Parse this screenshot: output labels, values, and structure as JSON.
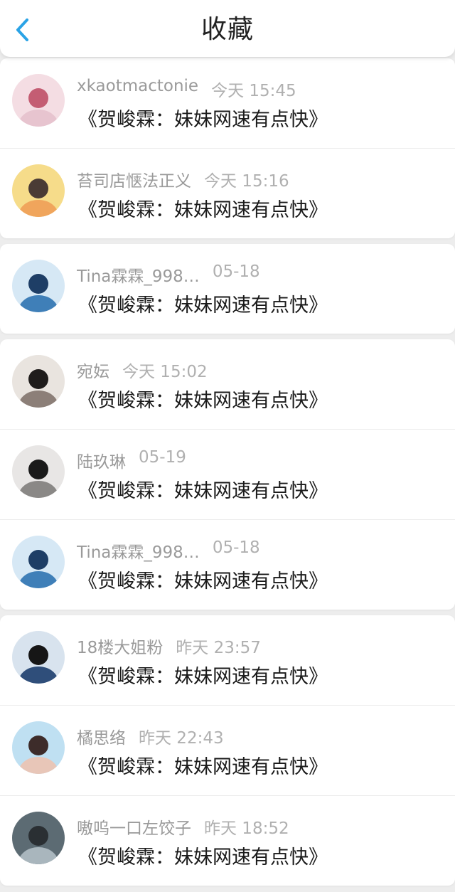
{
  "header": {
    "title": "收藏",
    "back_icon": "chevron-left-icon",
    "accent_color": "#2aa3e6"
  },
  "groups": [
    {
      "items": [
        {
          "name": "xkaotmactonie",
          "time": "今天 15:45",
          "title": "《贺峻霖：妹妹网速有点快》",
          "avatar_palette": [
            "#f4dde3",
            "#e7c4cf",
            "#c45d73"
          ]
        },
        {
          "name": "苔司店惬法正义",
          "time": "今天 15:16",
          "title": "《贺峻霖：妹妹网速有点快》",
          "avatar_palette": [
            "#f6dc8a",
            "#f0a55c",
            "#4a3b35"
          ]
        }
      ]
    },
    {
      "items": [
        {
          "name": "Tina霖霖_998…",
          "time": "05-18",
          "title": "《贺峻霖：妹妹网速有点快》",
          "avatar_palette": [
            "#d6e8f5",
            "#3f7fb8",
            "#1e3e66"
          ]
        }
      ]
    },
    {
      "items": [
        {
          "name": "宛妘",
          "time": "今天 15:02",
          "title": "《贺峻霖：妹妹网速有点快》",
          "avatar_palette": [
            "#e9e4df",
            "#8c7f78",
            "#1f1c1b"
          ]
        },
        {
          "name": "陆玖琳",
          "time": "05-19",
          "title": "《贺峻霖：妹妹网速有点快》",
          "avatar_palette": [
            "#e8e6e5",
            "#8a8886",
            "#1a1a1a"
          ]
        },
        {
          "name": "Tina霖霖_998…",
          "time": "05-18",
          "title": "《贺峻霖：妹妹网速有点快》",
          "avatar_palette": [
            "#d6e8f5",
            "#3f7fb8",
            "#1e3e66"
          ]
        }
      ]
    },
    {
      "items": [
        {
          "name": "18楼大姐粉",
          "time": "昨天 23:57",
          "title": "《贺峻霖：妹妹网速有点快》",
          "avatar_palette": [
            "#d8e3ee",
            "#2f4e7a",
            "#161616"
          ]
        },
        {
          "name": "橘思络",
          "time": "昨天 22:43",
          "title": "《贺峻霖：妹妹网速有点快》",
          "avatar_palette": [
            "#bfe0f2",
            "#e8c6b8",
            "#3d2c2a"
          ]
        },
        {
          "name": "嗷呜一口左饺子",
          "time": "昨天 18:52",
          "title": "《贺峻霖：妹妹网速有点快》",
          "avatar_palette": [
            "#5c6b73",
            "#a9b6bd",
            "#2a2f33"
          ]
        }
      ]
    }
  ]
}
